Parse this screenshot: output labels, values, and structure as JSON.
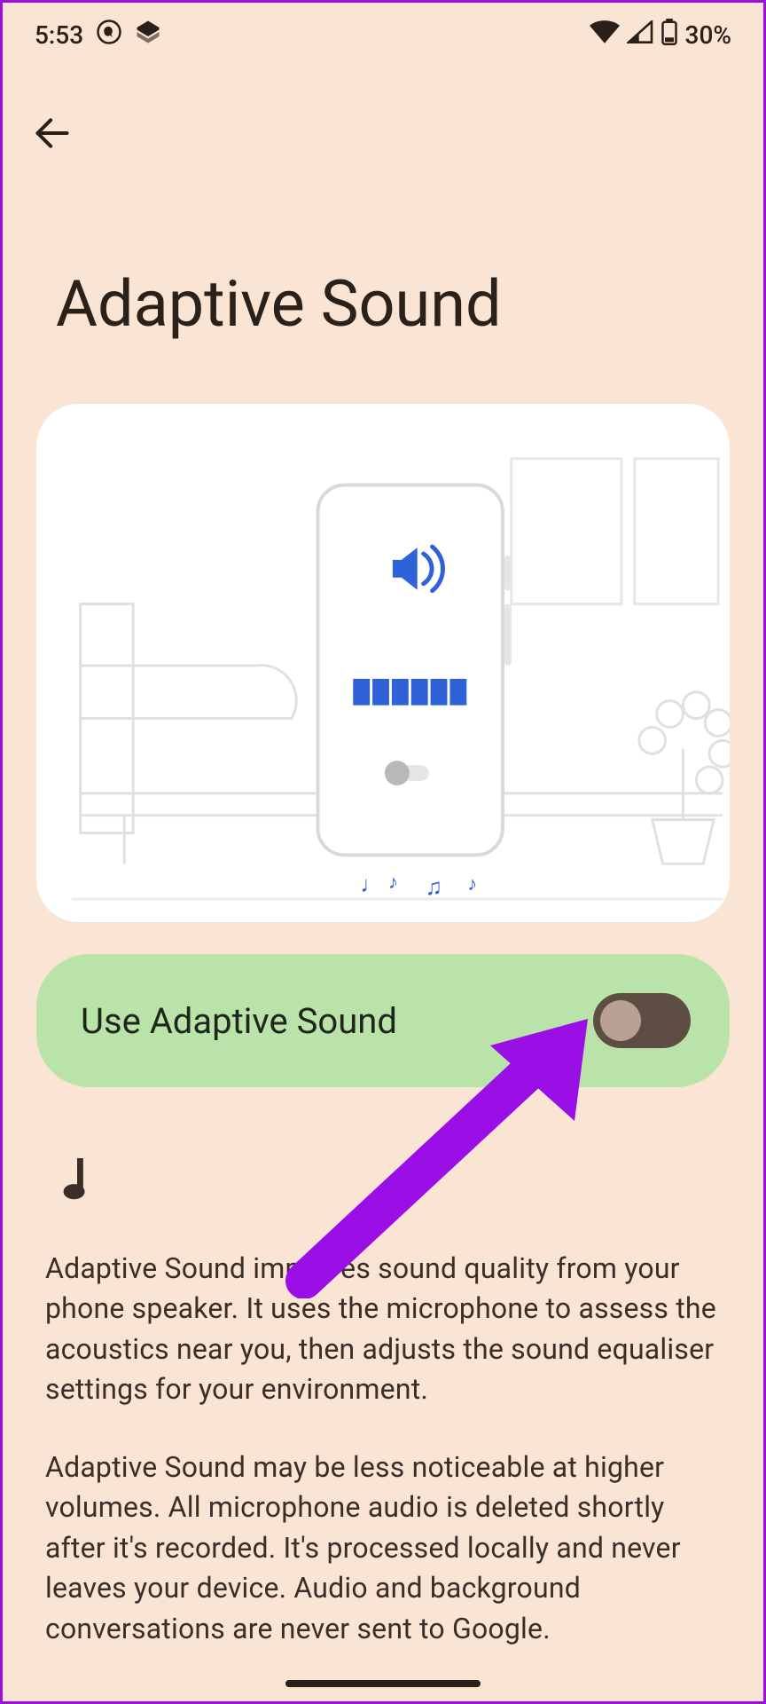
{
  "statusbar": {
    "time": "5:53",
    "battery_pct": "30%"
  },
  "page": {
    "title": "Adaptive Sound"
  },
  "setting": {
    "label": "Use Adaptive Sound",
    "toggled": false
  },
  "description": {
    "p1": "Adaptive Sound improves sound quality from your phone speaker. It uses the microphone to assess the acoustics near you, then adjusts the sound equaliser settings for your environment.",
    "p2": "Adaptive Sound may be less noticeable at higher volumes. All microphone audio is deleted shortly after it's recorded. It's processed locally and never leaves your device. Audio and background conversations are never sent to Google."
  }
}
